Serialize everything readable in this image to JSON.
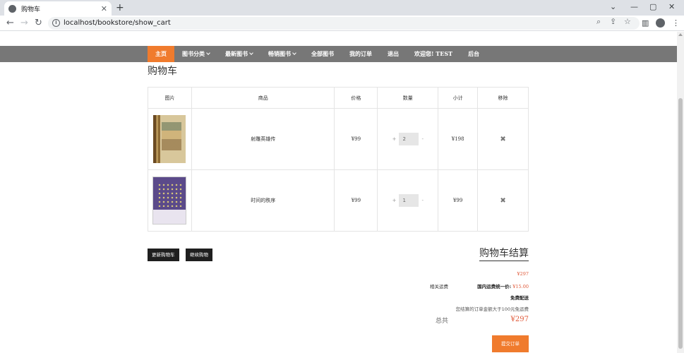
{
  "browser": {
    "tab_title": "购物车",
    "new_tab": "+",
    "url": "localhost/bookstore/show_cart",
    "window_controls": [
      "⌄",
      "—",
      "▢",
      "✕"
    ]
  },
  "nav": {
    "items": [
      {
        "label": "主页",
        "active": true,
        "caret": false
      },
      {
        "label": "图书分类",
        "active": false,
        "caret": true
      },
      {
        "label": "最新图书",
        "active": false,
        "caret": true
      },
      {
        "label": "畅销图书",
        "active": false,
        "caret": true
      },
      {
        "label": "全部图书",
        "active": false,
        "caret": false
      },
      {
        "label": "我的订单",
        "active": false,
        "caret": false
      },
      {
        "label": "退出",
        "active": false,
        "caret": false
      },
      {
        "label": "欢迎您! TEST",
        "active": false,
        "caret": false
      },
      {
        "label": "后台",
        "active": false,
        "caret": false
      }
    ]
  },
  "page": {
    "title": "购物车"
  },
  "cart": {
    "headers": [
      "图片",
      "商品",
      "价格",
      "数量",
      "小计",
      "移除"
    ],
    "rows": [
      {
        "name": "射雕英雄传",
        "price": "¥99",
        "minus": "+",
        "qty": "2",
        "plus": "-",
        "subtotal": "¥198",
        "remove": "✖"
      },
      {
        "name": "时间的秩序",
        "price": "¥99",
        "minus": "+",
        "qty": "1",
        "plus": "-",
        "subtotal": "¥99",
        "remove": "✖"
      }
    ]
  },
  "actions": {
    "update_cart": "更新购物车",
    "continue_shopping": "继续购物"
  },
  "summary": {
    "title": "购物车结算",
    "subtotal": "¥297",
    "shipping_label": "相关运费",
    "shipping_value_label": "国内运费统一价:",
    "shipping_value": "¥15.00",
    "free_shipping": "免费配送",
    "free_shipping_note": "您结算的订单金额大于100元免运费",
    "total_label": "总共",
    "total": "¥297",
    "checkout": "提交订单"
  }
}
